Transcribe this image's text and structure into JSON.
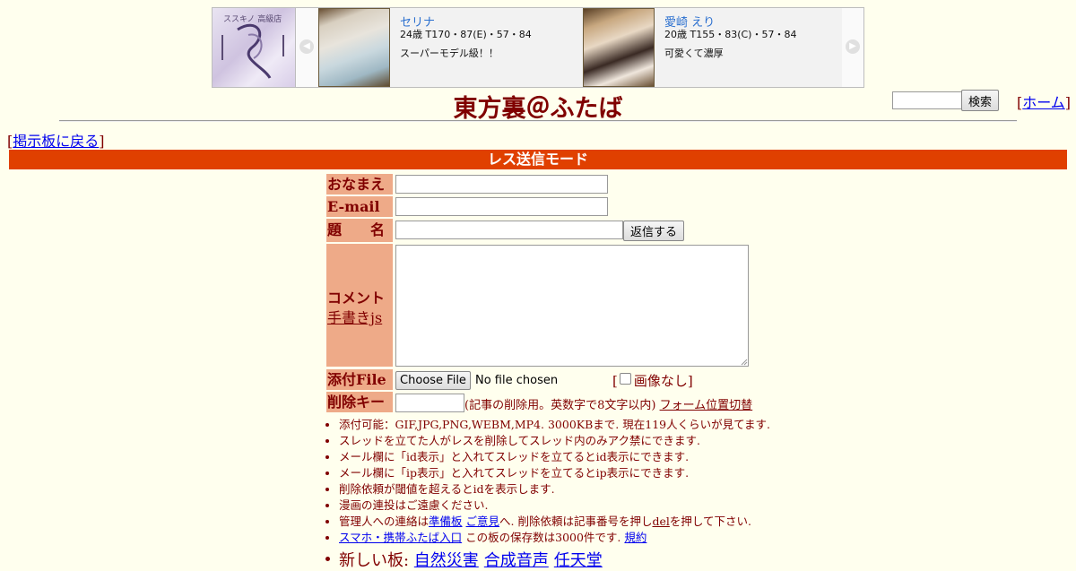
{
  "ad": {
    "logo_text": "ススキノ 高級店",
    "cards": [
      {
        "name": "セリナ",
        "stats": "24歳 T170・87(E)・57・84",
        "tagline": "スーパーモデル級！！"
      },
      {
        "name": "愛崎 えり",
        "stats": "20歳 T155・83(C)・57・84",
        "tagline": "可愛くて濃厚"
      }
    ]
  },
  "header": {
    "site_title": "東方裏＠ふたば",
    "search_button": "検索",
    "home_link": "ホーム",
    "back_link": "掲示板に戻る"
  },
  "mode_bar": "レス送信モード",
  "form": {
    "labels": {
      "name": "おなまえ",
      "email": "E-mail",
      "subject": "題　　名",
      "comment": "コメント",
      "handwriting": "手書きjs",
      "file": "添付File",
      "delete_key": "削除キー"
    },
    "reply_button": "返信する",
    "choose_file": "Choose File",
    "no_file": "No file chosen",
    "no_image": "画像なし",
    "delete_note": "(記事の削除用。英数字で8文字以内)",
    "form_position": "フォーム位置切替"
  },
  "info": {
    "line1": "添付可能：GIF,JPG,PNG,WEBM,MP4. 3000KBまで. 現在119人くらいが見てます.",
    "line2": "スレッドを立てた人がレスを削除してスレッド内のみアク禁にできます.",
    "line3": "メール欄に「id表示」と入れてスレッドを立てるとid表示にできます.",
    "line4": "メール欄に「ip表示」と入れてスレッドを立てるとip表示にできます.",
    "line5": "削除依頼が閾値を超えるとidを表示します.",
    "line6": "漫画の連投はご遠慮ください.",
    "line7_prefix": "管理人への連絡は",
    "line7_link1": "準備板",
    "line7_link2": "ご意見",
    "line7_mid": "へ. 削除依頼は記事番号を押し",
    "line7_del": "del",
    "line7_suffix": "を押して下さい.",
    "line8_link": "スマホ・携帯ふたば入口",
    "line8_text": " この板の保存数は3000件です.",
    "line8_rules": "規約"
  },
  "new_boards": {
    "label": "新しい板: ",
    "boards": [
      "自然災害",
      "合成音声",
      "任天堂"
    ]
  },
  "colors": {
    "background": "#ffffee",
    "text": "#800000",
    "mode_bar": "#e04000",
    "label_cell": "#eeaa88",
    "link": "#0000ee"
  }
}
